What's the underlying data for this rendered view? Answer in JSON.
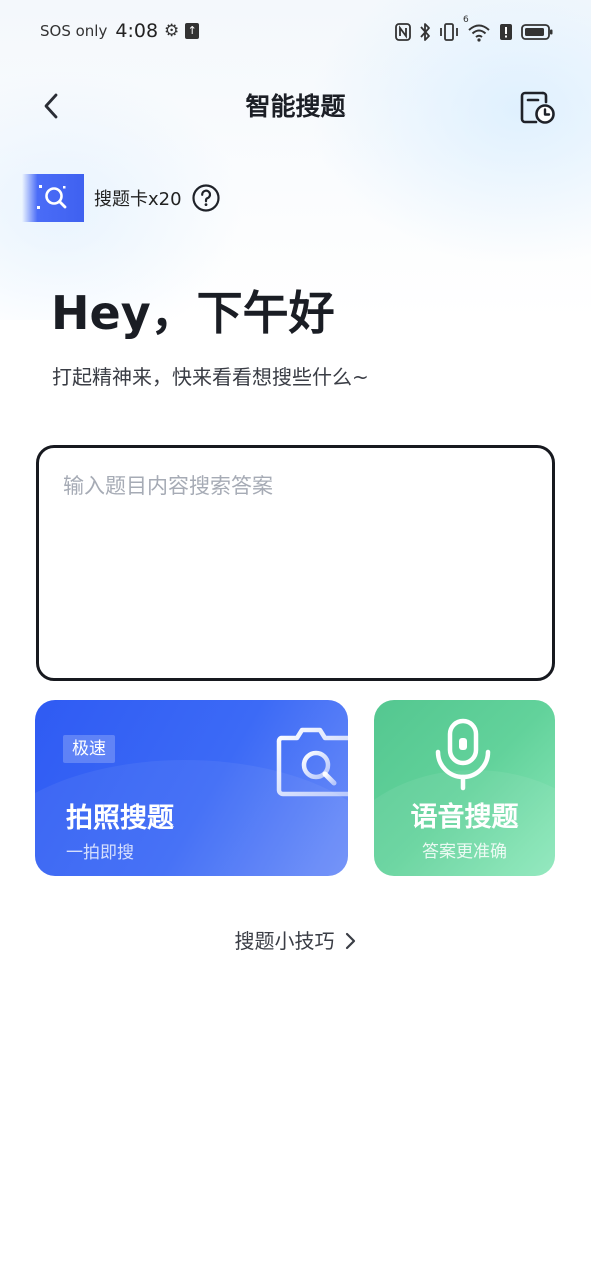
{
  "status_bar": {
    "carrier": "SOS only",
    "time": "4:08",
    "icons": [
      "gear-icon",
      "upload-icon",
      "nfc-icon",
      "bluetooth-icon",
      "vibrate-icon",
      "wifi-icon",
      "alert-icon",
      "battery-icon"
    ],
    "wifi_badge": "6"
  },
  "header": {
    "title": "智能搜题",
    "back_icon": "chevron-left-icon",
    "history_icon": "history-clock-icon"
  },
  "search_card": {
    "label": "搜题卡x20",
    "help_icon": "question-circle-icon"
  },
  "greeting": {
    "title": "Hey，下午好",
    "subtitle": "打起精神来，快来看看想搜些什么~"
  },
  "search": {
    "placeholder": "输入题目内容搜索答案",
    "value": ""
  },
  "photo_search": {
    "badge": "极速",
    "title": "拍照搜题",
    "subtitle": "一拍即搜",
    "icon": "camera-search-icon"
  },
  "voice_search": {
    "title": "语音搜题",
    "subtitle": "答案更准确",
    "icon": "microphone-icon"
  },
  "tips": {
    "label": "搜题小技巧",
    "icon": "chevron-right-icon"
  },
  "colors": {
    "photo_card": "#3c6af6",
    "voice_card": "#5ccb95",
    "text_primary": "#1c1f26",
    "placeholder": "#a6abb5"
  }
}
